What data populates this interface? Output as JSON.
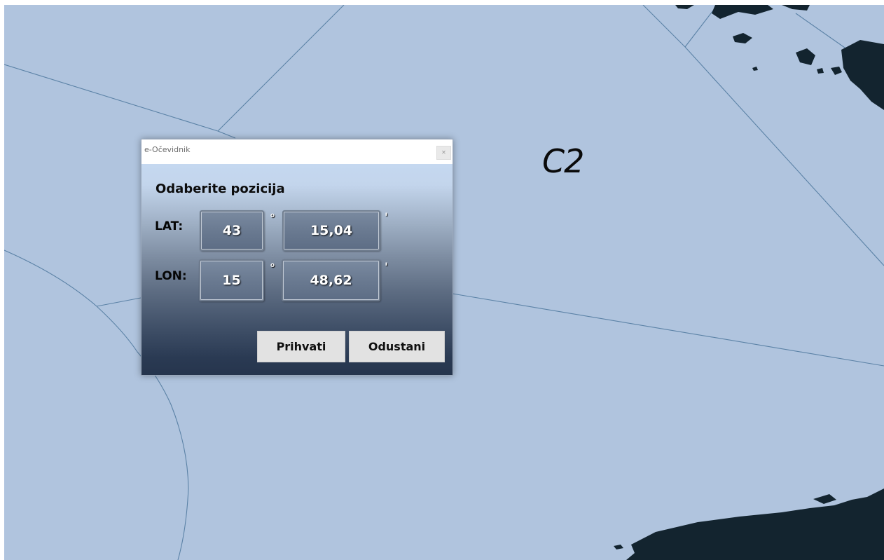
{
  "map": {
    "zone_label": "C2",
    "water_color": "#b0c4de",
    "land_color": "#13242f",
    "line_color": "#5b82a6"
  },
  "dialog": {
    "title": "e-Očevidnik",
    "close_icon": "close-icon",
    "heading": "Odaberite pozicija",
    "lat": {
      "label": "LAT:",
      "degrees": "43",
      "degree_symbol": "°",
      "minutes": "15,04",
      "minute_symbol": "'"
    },
    "lon": {
      "label": "LON:",
      "degrees": "15",
      "degree_symbol": "°",
      "minutes": "48,62",
      "minute_symbol": "'"
    },
    "accept_label": "Prihvati",
    "cancel_label": "Odustani"
  }
}
